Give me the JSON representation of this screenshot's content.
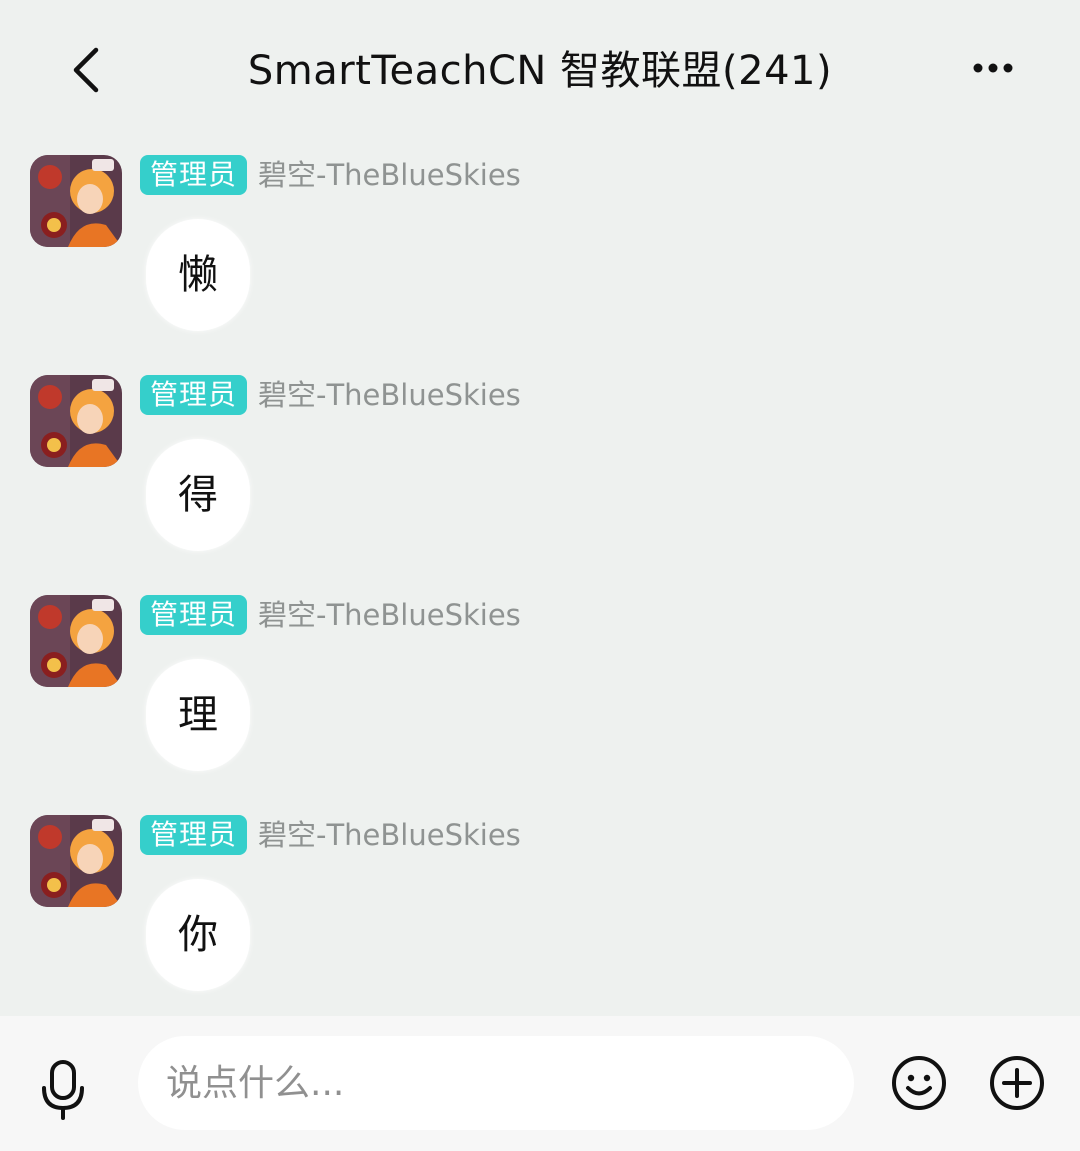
{
  "header": {
    "title": "SmartTeachCN 智教联盟(241)",
    "back_icon": "chevron-left-icon",
    "more_icon": "more-horizontal-icon"
  },
  "messages": [
    {
      "role": "管理员",
      "sender": "碧空-TheBlueSkies",
      "text": "懒"
    },
    {
      "role": "管理员",
      "sender": "碧空-TheBlueSkies",
      "text": "得"
    },
    {
      "role": "管理员",
      "sender": "碧空-TheBlueSkies",
      "text": "理"
    },
    {
      "role": "管理员",
      "sender": "碧空-TheBlueSkies",
      "text": "你"
    }
  ],
  "input_bar": {
    "placeholder": "说点什么...",
    "value": "",
    "voice_icon": "microphone-icon",
    "emoji_icon": "smiley-icon",
    "plus_icon": "plus-circle-icon"
  },
  "colors": {
    "background": "#eef1ef",
    "badge": "#35cfcb",
    "sender_name": "#8f9392",
    "bubble": "#ffffff",
    "input_bar": "#f7f7f7"
  }
}
